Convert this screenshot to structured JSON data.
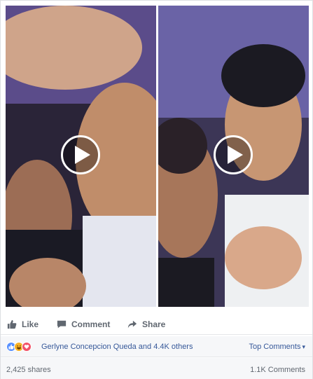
{
  "videos": [
    {
      "name": "left-video",
      "play_icon": "play-icon"
    },
    {
      "name": "right-video",
      "play_icon": "play-icon"
    }
  ],
  "actions": {
    "like_label": "Like",
    "comment_label": "Comment",
    "share_label": "Share"
  },
  "reactions": {
    "icons": [
      "like-reaction-icon",
      "haha-reaction-icon",
      "love-reaction-icon"
    ],
    "summary": "Gerlyne Concepcion Queda and 4.4K others",
    "top_comments_label": "Top Comments",
    "top_comments_caret": "▾"
  },
  "stats": {
    "shares": "2,425 shares",
    "comments": "1.1K Comments"
  },
  "colors": {
    "link": "#365899",
    "muted": "#606770",
    "like": "#5890ff",
    "haha": "#f7b125",
    "love": "#f25268"
  }
}
